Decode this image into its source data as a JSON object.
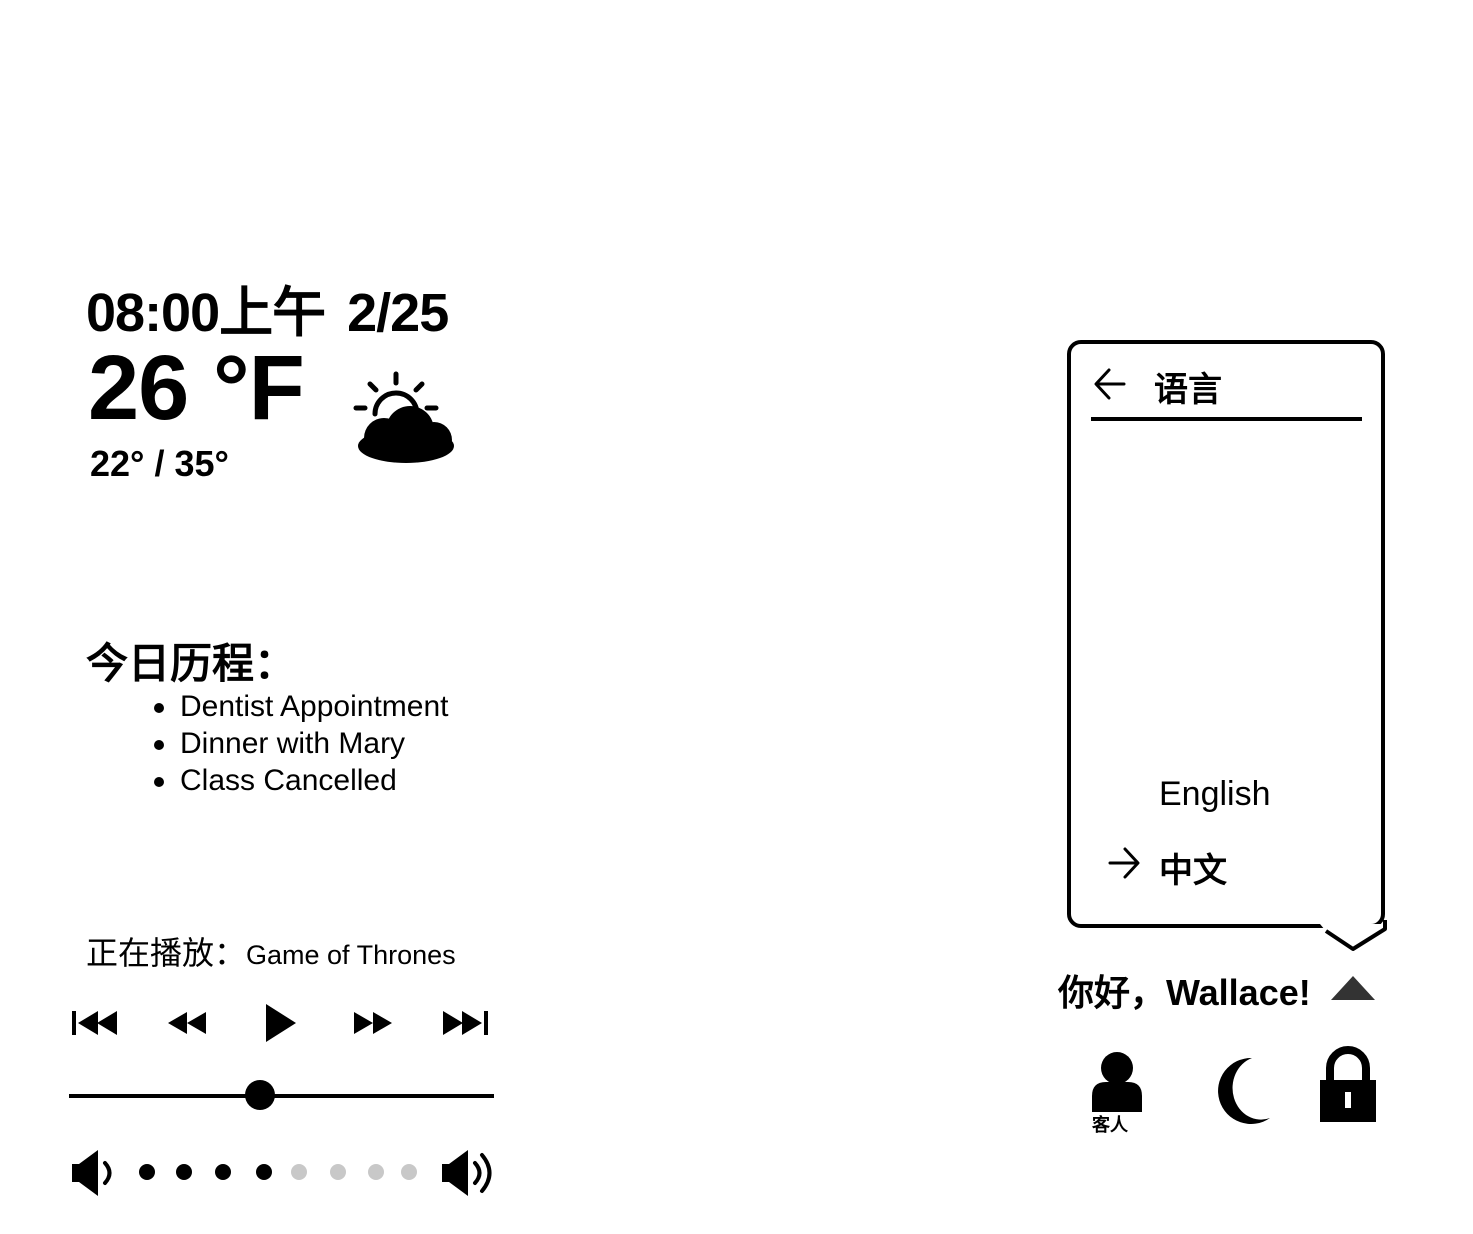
{
  "clock": {
    "time": "08:00上午",
    "date": "2/25"
  },
  "weather": {
    "current_temp": "26 °F",
    "range": "22° / 35°",
    "condition_icon": "partly-cloudy-icon"
  },
  "schedule": {
    "title": "今日历程：",
    "items": [
      "Dentist Appointment",
      "Dinner with Mary",
      "Class Cancelled"
    ]
  },
  "media": {
    "now_playing_label": "正在播放：",
    "now_playing_title": "Game of Thrones",
    "controls": [
      "skip-previous-icon",
      "rewind-icon",
      "play-icon",
      "fast-forward-icon",
      "skip-next-icon"
    ],
    "progress_fraction": 0.45,
    "volume_level": 4,
    "volume_steps": 8,
    "colors": {
      "volume_on": "#000000",
      "volume_off": "#c8c8c8"
    }
  },
  "language_panel": {
    "title": "语言",
    "back_icon": "arrow-left-icon",
    "options": [
      "English",
      "中文"
    ],
    "selected": "中文",
    "selected_icon": "arrow-right-icon"
  },
  "user": {
    "greeting": "你好，Wallace!",
    "toggle_icon": "caret-up-icon",
    "guest_label": "客人",
    "icons": [
      "user-icon",
      "moon-icon",
      "lock-icon"
    ]
  }
}
